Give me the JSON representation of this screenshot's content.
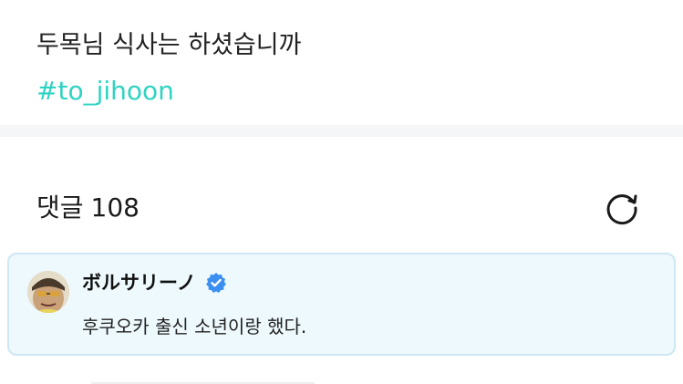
{
  "post": {
    "text": "두목님 식사는 하셨습니까",
    "hashtag": "#to_jihoon"
  },
  "comments": {
    "label": "댓글",
    "count": "108",
    "refresh_icon": "refresh-icon"
  },
  "comment": {
    "author": "ボルサリーノ",
    "verified_icon": "verified-badge-icon",
    "text": "후쿠오카 출신 소년이랑 했다.",
    "accent_bg": "#edf9fd",
    "accent_border": "#cfe7f2"
  },
  "colors": {
    "hashtag": "#2ed3c1",
    "verified": "#3b8ff0"
  }
}
